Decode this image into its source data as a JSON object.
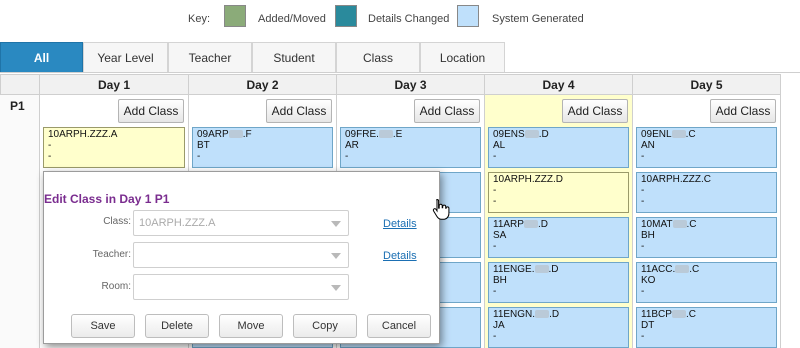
{
  "key": {
    "label": "Key:",
    "items": [
      {
        "label": "Added/Moved",
        "color": "#8bab79"
      },
      {
        "label": "Details Changed",
        "color": "#2a8a9c"
      },
      {
        "label": "System Generated",
        "color": "#bfe0fb"
      }
    ]
  },
  "tabs": [
    "All",
    "Year Level",
    "Teacher",
    "Student",
    "Class",
    "Location"
  ],
  "grid": {
    "period": "P1",
    "add_label": "Add Class",
    "days": [
      "Day 1",
      "Day 2",
      "Day 3",
      "Day 4",
      "Day 5"
    ],
    "columns": [
      {
        "cards": [
          {
            "code": "10ARPH.ZZZ.A",
            "l2": "-",
            "l3": "-",
            "variant": "yellow"
          }
        ]
      },
      {
        "cards": [
          {
            "code_a": "09ARP",
            "code_b": ".F",
            "l2": "BT",
            "l3": "-",
            "variant": "blue"
          }
        ]
      },
      {
        "cards": [
          {
            "code_a": "09FRE.",
            "code_b": ".E",
            "l2": "AR",
            "l3": "-",
            "variant": "blue"
          }
        ]
      },
      {
        "cards": [
          {
            "code_a": "09ENS",
            "code_b": ".D",
            "l2": "AL",
            "l3": "-",
            "variant": "blue"
          },
          {
            "code": "10ARPH.ZZZ.D",
            "l2": "-",
            "l3": "-",
            "variant": "yellow"
          },
          {
            "code_a": "11ARP",
            "code_b": ".D",
            "l2": "SA",
            "l3": "-",
            "variant": "blue"
          },
          {
            "code_a": "11ENGE.",
            "code_b": ".D",
            "l2": "BH",
            "l3": "-",
            "variant": "blue"
          },
          {
            "code_a": "11ENGN.",
            "code_b": ".D",
            "l2": "JA",
            "l3": "-",
            "variant": "blue"
          }
        ]
      },
      {
        "cards": [
          {
            "code_a": "09ENL",
            "code_b": ".C",
            "l2": "AN",
            "l3": "-",
            "variant": "blue"
          },
          {
            "code": "10ARPH.ZZZ.C",
            "l2": "-",
            "l3": "-",
            "variant": "blue"
          },
          {
            "code_a": "10MAT",
            "code_b": ".C",
            "l2": "BH",
            "l3": "-",
            "variant": "blue"
          },
          {
            "code_a": "11ACC.",
            "code_b": ".C",
            "l2": "KO",
            "l3": "-",
            "variant": "blue"
          },
          {
            "code_a": "11BCP",
            "code_b": ".C",
            "l2": "DT",
            "l3": "-",
            "variant": "blue"
          }
        ]
      }
    ]
  },
  "dialog": {
    "title": "Edit Class in Day 1 P1",
    "fields": [
      {
        "label": "Class:",
        "value": "10ARPH.ZZZ.A",
        "has_details": true
      },
      {
        "label": "Teacher:",
        "value": "",
        "has_details": true
      },
      {
        "label": "Room:",
        "value": "",
        "has_details": false
      }
    ],
    "details_label": "Details",
    "buttons": [
      "Save",
      "Delete",
      "Move",
      "Copy",
      "Cancel"
    ]
  }
}
